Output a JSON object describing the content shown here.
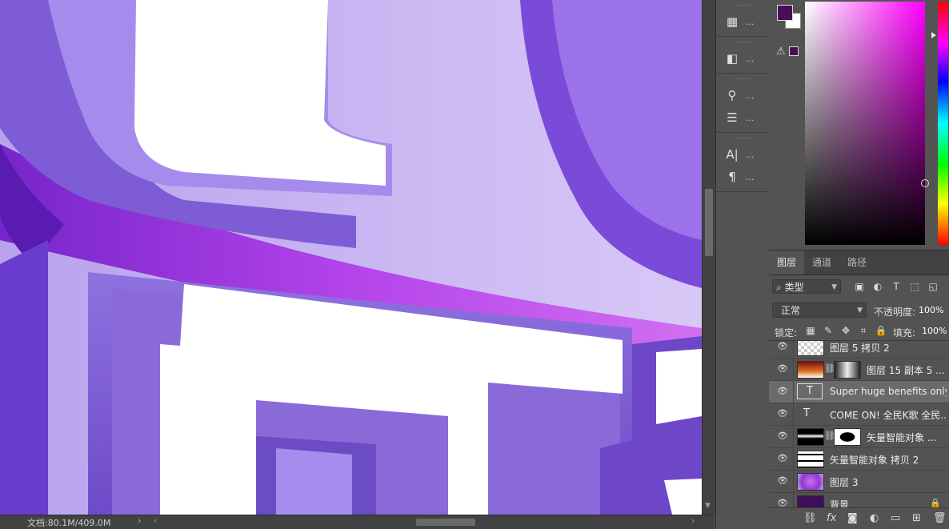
{
  "status": {
    "doc_info": "文档:80.1M/409.0M"
  },
  "dock_tools": [
    {
      "name": "3d-panel-icon",
      "glyph": "▦"
    },
    {
      "name": "properties-icon",
      "glyph": "◧"
    },
    {
      "name": "brush-presets-icon",
      "glyph": "⚲"
    },
    {
      "name": "adjust-sliders-icon",
      "glyph": "☰"
    },
    {
      "name": "character-icon",
      "glyph": "A|"
    },
    {
      "name": "paragraph-icon",
      "glyph": "¶"
    }
  ],
  "dock_dots": "...",
  "color_panel": {
    "foreground_color": "#4a0e56",
    "background_color": "#ffffff",
    "gamut_warning_glyph": "⚠"
  },
  "layers_panel": {
    "tabs": [
      "图层",
      "通道",
      "路径"
    ],
    "filter_label": "类型",
    "blend_mode": "正常",
    "opacity_label": "不透明度:",
    "opacity_value": "100%",
    "lock_label": "锁定:",
    "fill_label": "填充:",
    "fill_value": "100%",
    "layers": [
      {
        "name": "图层 5 拷贝 2",
        "kind": "pixel",
        "selected": false
      },
      {
        "name": "图层 15 副本 5 ...",
        "kind": "masked",
        "selected": false
      },
      {
        "name": "Super huge benefits only t...",
        "kind": "text",
        "selected": true
      },
      {
        "name": "COME ON! 全民K歌  全民...",
        "kind": "text-plain",
        "selected": false
      },
      {
        "name": "矢量智能对象 ...",
        "kind": "masked-smart",
        "selected": false
      },
      {
        "name": "矢量智能对象 拷贝 2",
        "kind": "smart",
        "selected": false
      },
      {
        "name": "图层 3",
        "kind": "pixel",
        "selected": false
      },
      {
        "name": "背景",
        "kind": "background",
        "selected": false
      }
    ]
  }
}
